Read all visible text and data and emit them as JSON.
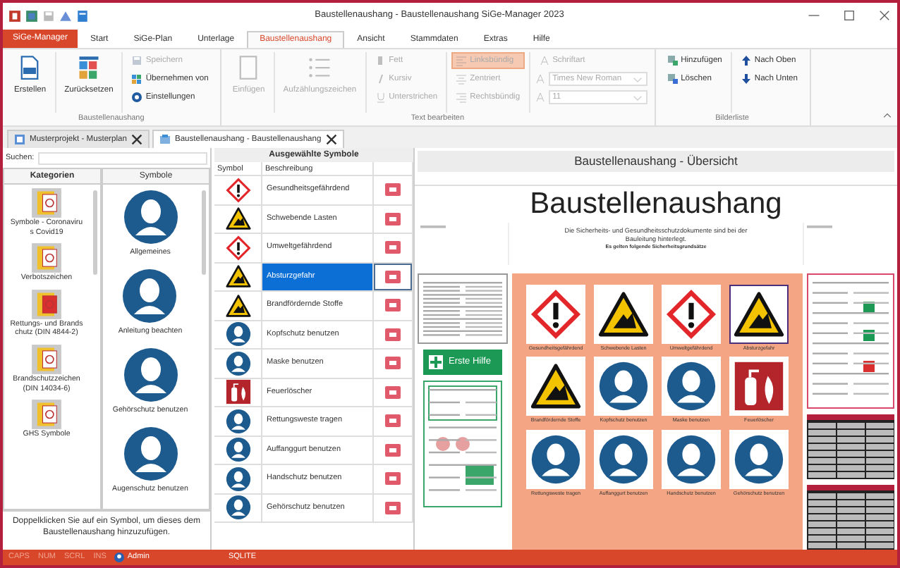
{
  "window": {
    "title": "Baustellenaushang - Baustellenaushang SiGe-Manager 2023"
  },
  "app_button": "SiGe-Manager",
  "ribbon_tabs": [
    {
      "label": "Start",
      "selected": false
    },
    {
      "label": "SiGe-Plan",
      "selected": false
    },
    {
      "label": "Unterlage",
      "selected": false
    },
    {
      "label": "Baustellenaushang",
      "selected": true
    },
    {
      "label": "Ansicht",
      "selected": false
    },
    {
      "label": "Stammdaten",
      "selected": false
    },
    {
      "label": "Extras",
      "selected": false
    },
    {
      "label": "Hilfe",
      "selected": false
    }
  ],
  "ribbon": {
    "groups": [
      {
        "label": "Baustellenaushang",
        "columns": [
          {
            "items": [
              {
                "label": "Erstellen",
                "kind": "large",
                "disabled": false
              }
            ]
          },
          {
            "items": [
              {
                "label": "Zurücksetzen",
                "kind": "large",
                "disabled": false
              }
            ]
          },
          {
            "items": [
              {
                "label": "Speichern",
                "kind": "small",
                "disabled": true
              },
              {
                "label": "Übernehmen von",
                "kind": "small",
                "disabled": false
              },
              {
                "label": "Einstellungen",
                "kind": "small",
                "disabled": false
              }
            ]
          }
        ]
      },
      {
        "label": "Text bearbeiten",
        "columns": [
          {
            "items": [
              {
                "label": "Einfügen",
                "kind": "large",
                "disabled": true
              }
            ]
          },
          {
            "items": [
              {
                "label": "Aufzählungszeichen",
                "kind": "large",
                "disabled": true
              }
            ]
          },
          {
            "items": [
              {
                "label": "Fett",
                "kind": "small",
                "disabled": true,
                "checked": false
              },
              {
                "label": "Kursiv",
                "kind": "small",
                "disabled": true,
                "checked": false
              },
              {
                "label": "Unterstrichen",
                "kind": "small",
                "disabled": true,
                "checked": false
              }
            ]
          },
          {
            "items": [
              {
                "label": "Linksbündig",
                "kind": "small",
                "disabled": true,
                "checked": true
              },
              {
                "label": "Zentriert",
                "kind": "small",
                "disabled": true,
                "checked": false
              },
              {
                "label": "Rechtsbündig",
                "kind": "small",
                "disabled": true,
                "checked": false
              }
            ]
          },
          {
            "items": [
              {
                "label": "Schriftart",
                "kind": "small",
                "disabled": true,
                "checked": false
              },
              {
                "label": "Times New Roman",
                "kind": "combo",
                "disabled": true
              },
              {
                "label": "11",
                "kind": "combo",
                "disabled": true
              }
            ]
          }
        ]
      },
      {
        "label": "Bilderliste",
        "columns": [
          {
            "items": [
              {
                "label": "Hinzufügen",
                "kind": "small",
                "disabled": false
              },
              {
                "label": "Löschen",
                "kind": "small",
                "disabled": false
              }
            ]
          },
          {
            "items": [
              {
                "label": "Nach Oben",
                "kind": "small",
                "disabled": false
              },
              {
                "label": "Nach Unten",
                "kind": "small",
                "disabled": false
              }
            ]
          }
        ]
      }
    ]
  },
  "document_tabs": [
    {
      "label": "Musterprojekt - Musterplan",
      "selected": false
    },
    {
      "label": "Baustellenaushang - Baustellenaushang",
      "selected": true
    }
  ],
  "search": {
    "label": "Suchen:"
  },
  "categories": {
    "heading": "Kategorien",
    "items": [
      {
        "label": "Symbole - Coronavirus Covid19"
      },
      {
        "label": "Verbotszeichen"
      },
      {
        "label": "Rettungs- und Brandschutz (DIN 4844-2)"
      },
      {
        "label": "Brandschutzzeichen (DIN 14034-6)"
      },
      {
        "label": "GHS Symbole"
      }
    ]
  },
  "symbols": {
    "heading": "Symbole",
    "items": [
      {
        "label": "Allgemeines"
      },
      {
        "label": "Anleitung beachten"
      },
      {
        "label": "Gehörschutz benutzen"
      },
      {
        "label": "Augenschutz benutzen"
      }
    ]
  },
  "hint": "Doppelklicken Sie auf ein Symbol, um dieses dem Baustellenaushang hinzuzufügen.",
  "selected_symbols": {
    "title": "Ausgewählte Symbole",
    "columns": [
      "Symbol",
      "Beschreibung"
    ],
    "rows": [
      {
        "description": "Gesundheitsgefährdend",
        "kind": "ghs",
        "selected": false
      },
      {
        "description": "Schwebende Lasten",
        "kind": "warning",
        "selected": false
      },
      {
        "description": "Umweltgefährdend",
        "kind": "ghs",
        "selected": false
      },
      {
        "description": "Absturzgefahr",
        "kind": "warning",
        "selected": true
      },
      {
        "description": "Brandfördernde Stoffe",
        "kind": "warning",
        "selected": false
      },
      {
        "description": "Kopfschutz benutzen",
        "kind": "mandatory",
        "selected": false
      },
      {
        "description": "Maske benutzen",
        "kind": "mandatory",
        "selected": false
      },
      {
        "description": "Feuerlöscher",
        "kind": "fire",
        "selected": false
      },
      {
        "description": "Rettungsweste tragen",
        "kind": "mandatory",
        "selected": false
      },
      {
        "description": "Auffanggurt benutzen",
        "kind": "mandatory",
        "selected": false
      },
      {
        "description": "Handschutz benutzen",
        "kind": "mandatory",
        "selected": false
      },
      {
        "description": "Gehörschutz benutzen",
        "kind": "mandatory",
        "selected": false
      }
    ]
  },
  "preview": {
    "title": "Baustellenaushang - Übersicht",
    "poster": {
      "heading": "Baustellenaushang",
      "subtitle": "Die Sicherheits- und Gesundheitsschutzdokumente sind bei der Bauleitung hinterlegt.",
      "note": "Es gelten folgende Sicherheitsgrundsätze",
      "first_aid": "Erste Hilfe",
      "signs": [
        {
          "caption": "Gesundheitsgefährdend",
          "kind": "ghs",
          "selected": false
        },
        {
          "caption": "Schwebende Lasten",
          "kind": "warning",
          "selected": false
        },
        {
          "caption": "Umweltgefährdend",
          "kind": "ghs",
          "selected": false
        },
        {
          "caption": "Absturzgefahr",
          "kind": "warning",
          "selected": true
        },
        {
          "caption": "Brandfördernde Stoffe",
          "kind": "warning",
          "selected": false
        },
        {
          "caption": "Kopfschutz benutzen",
          "kind": "mandatory",
          "selected": false
        },
        {
          "caption": "Maske benutzen",
          "kind": "mandatory",
          "selected": false
        },
        {
          "caption": "Feuerlöscher",
          "kind": "fire",
          "selected": false
        },
        {
          "caption": "Rettungsweste tragen",
          "kind": "mandatory",
          "selected": false
        },
        {
          "caption": "Auffanggurt benutzen",
          "kind": "mandatory",
          "selected": false
        },
        {
          "caption": "Handschutz benutzen",
          "kind": "mandatory",
          "selected": false
        },
        {
          "caption": "Gehörschutz benutzen",
          "kind": "mandatory",
          "selected": false
        }
      ]
    }
  },
  "status_bar": {
    "indicators": [
      "CAPS",
      "NUM",
      "SCRL",
      "INS"
    ],
    "user": "Admin",
    "database": "SQLITE"
  }
}
